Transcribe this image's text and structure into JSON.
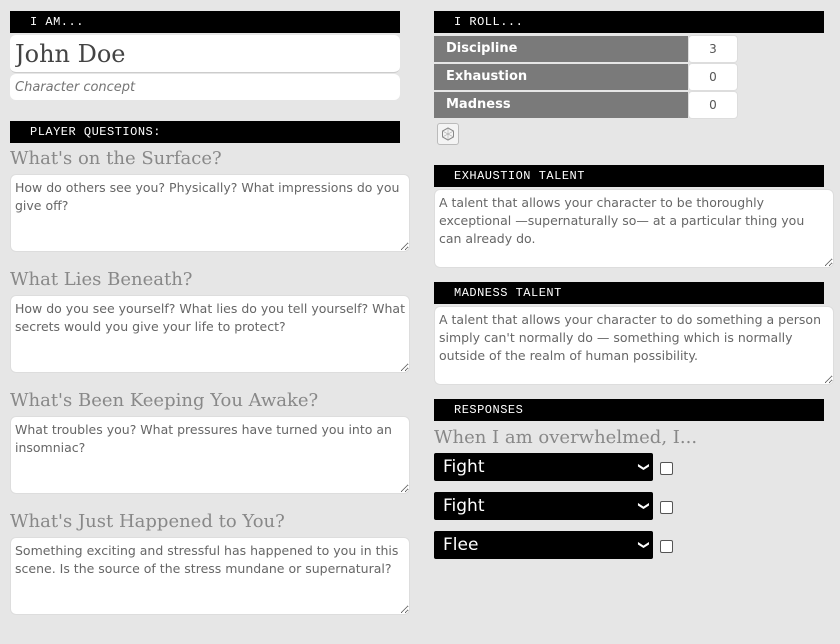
{
  "identity": {
    "header": "I AM...",
    "name_value": "John Doe",
    "concept_placeholder": "Character concept"
  },
  "questions": {
    "header": "PLAYER QUESTIONS:",
    "items": [
      {
        "title": "What's on the Surface?",
        "placeholder": "How do others see you? Physically? What impressions do you give off?"
      },
      {
        "title": "What Lies Beneath?",
        "placeholder": "How do you see yourself? What lies do you tell yourself? What secrets would you give your life to protect?"
      },
      {
        "title": "What's Been Keeping You Awake?",
        "placeholder": "What troubles you? What pressures have turned you into an insomniac?"
      },
      {
        "title": "What's Just Happened to You?",
        "placeholder": "Something exciting and stressful has happened to you in this scene. Is the source of the stress mundane or supernatural?"
      }
    ]
  },
  "roll": {
    "header": "I ROLL...",
    "stats": [
      {
        "label": "Discipline",
        "value": "3"
      },
      {
        "label": "Exhaustion",
        "value": "0"
      },
      {
        "label": "Madness",
        "value": "0"
      }
    ],
    "roll_button_icon": "dice-icon"
  },
  "exhaustion_talent": {
    "header": "EXHAUSTION TALENT",
    "placeholder": "A talent that allows your character to be thoroughly exceptional —supernaturally so— at a particular thing you can already do."
  },
  "madness_talent": {
    "header": "MADNESS TALENT",
    "placeholder": "A talent that allows your character to do something a person simply can't normally do — something which is normally outside of the realm of human possibility."
  },
  "responses": {
    "header": "RESPONSES",
    "prompt": "When I am overwhelmed, I...",
    "options": [
      {
        "selected": "Fight",
        "checked": false
      },
      {
        "selected": "Fight",
        "checked": false
      },
      {
        "selected": "Flee",
        "checked": false
      }
    ]
  },
  "colors": {
    "background": "#e6e6e6",
    "header_bg": "#000000",
    "stat_label_bg": "#7a7a7a",
    "title_text": "#888888"
  }
}
